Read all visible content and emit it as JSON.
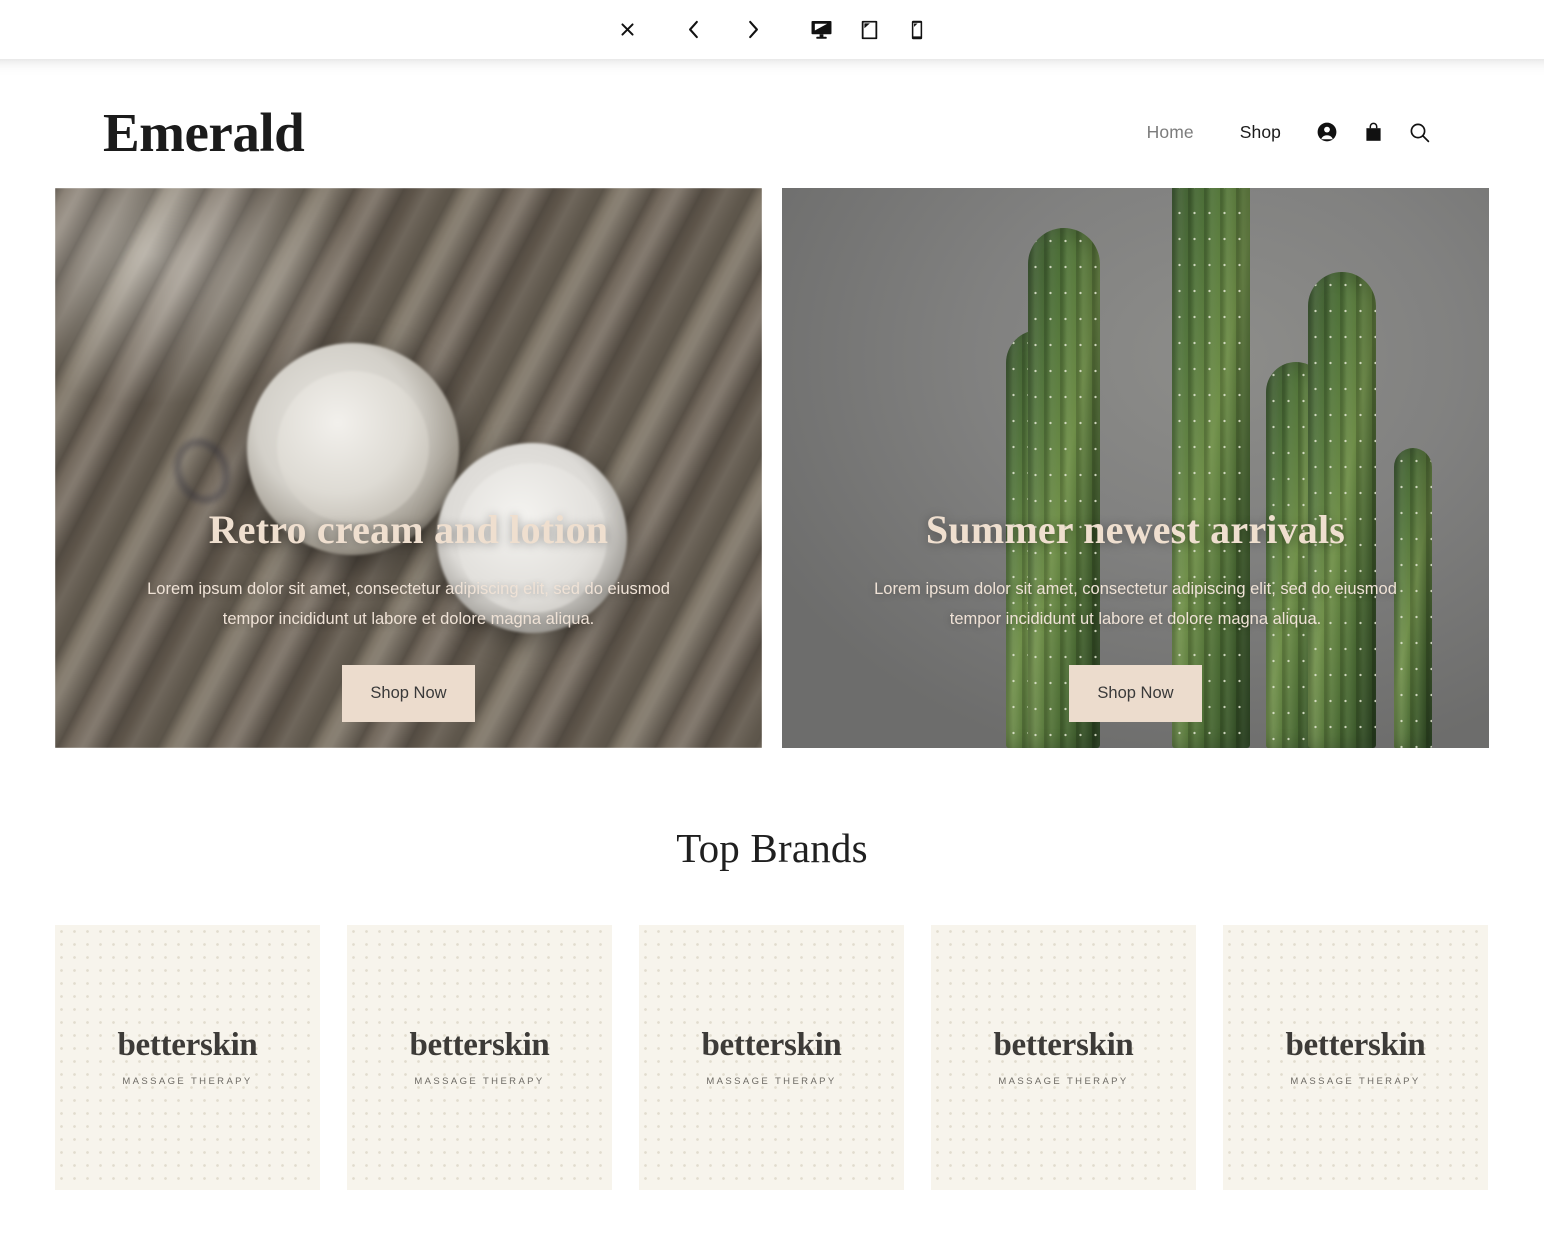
{
  "preview_toolbar": {
    "buttons": [
      {
        "name": "close-preview",
        "icon": "close-icon",
        "label": "×"
      },
      {
        "name": "back",
        "icon": "chevron-left-icon",
        "label": "‹"
      },
      {
        "name": "forward",
        "icon": "chevron-right-icon",
        "label": "›"
      },
      {
        "name": "desktop-view",
        "icon": "desktop-icon",
        "label": ""
      },
      {
        "name": "tablet-view",
        "icon": "tablet-icon",
        "label": ""
      },
      {
        "name": "mobile-view",
        "icon": "mobile-icon",
        "label": ""
      }
    ]
  },
  "header": {
    "logo": "Emerald",
    "nav": [
      {
        "label": "Home",
        "active": false
      },
      {
        "label": "Shop",
        "active": true
      }
    ],
    "icons": [
      {
        "name": "account-icon",
        "label": "Account"
      },
      {
        "name": "shopping-bag-icon",
        "label": "Cart"
      },
      {
        "name": "search-icon",
        "label": "Search"
      }
    ]
  },
  "heroes": [
    {
      "title": "Retro cream and lotion",
      "description": "Lorem ipsum dolor sit amet, consectetur adipiscing elit, sed do eiusmod tempor incididunt ut labore et dolore magna aliqua.",
      "cta": "Shop Now",
      "image_alt": "retro-cream-jars-on-wood"
    },
    {
      "title": "Summer newest arrivals",
      "description": "Lorem ipsum dolor sit amet, consectetur adipiscing elit, sed do eiusmod tempor incididunt ut labore et dolore magna aliqua.",
      "cta": "Shop Now",
      "image_alt": "cacti-against-grey-wall"
    }
  ],
  "brands": {
    "title": "Top Brands",
    "cards": [
      {
        "name": "betterskin",
        "tagline": "MASSAGE THERAPY"
      },
      {
        "name": "betterskin",
        "tagline": "MASSAGE THERAPY"
      },
      {
        "name": "betterskin",
        "tagline": "MASSAGE THERAPY"
      },
      {
        "name": "betterskin",
        "tagline": "MASSAGE THERAPY"
      },
      {
        "name": "betterskin",
        "tagline": "MASSAGE THERAPY"
      }
    ]
  },
  "colors": {
    "accent_cream": "#ecdccd",
    "hero_title": "#efdfcf",
    "card_bg": "#f7f4ec",
    "text_dark": "#1b1b1b",
    "nav_muted": "#7c7c7c"
  }
}
